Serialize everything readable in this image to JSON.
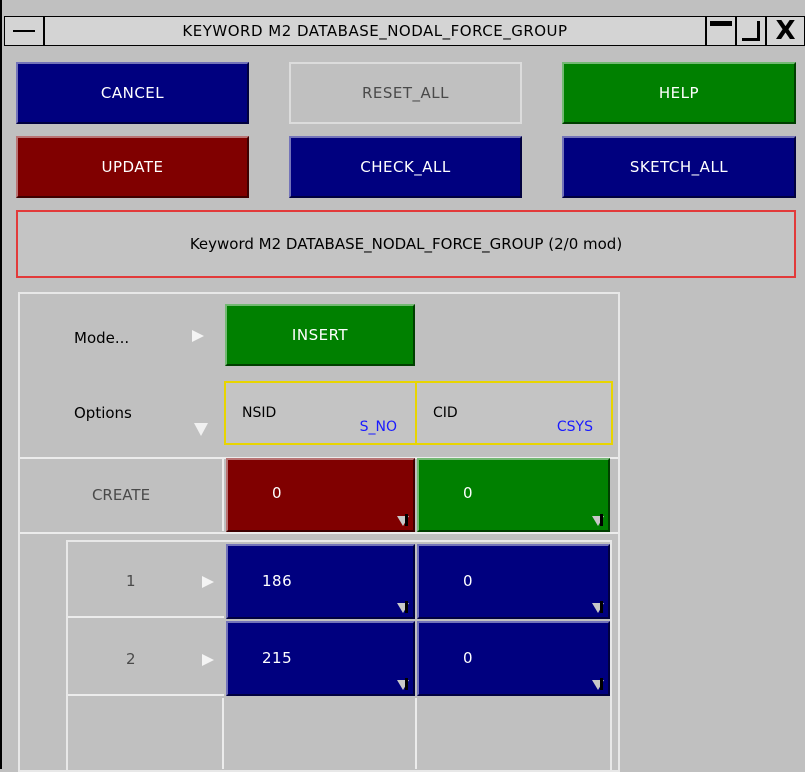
{
  "window": {
    "title": "KEYWORD M2 DATABASE_NODAL_FORCE_GROUP",
    "close_glyph": "X"
  },
  "toolbar": {
    "cancel": "CANCEL",
    "reset_all": "RESET_ALL",
    "help": "HELP",
    "update": "UPDATE",
    "check_all": "CHECK_ALL",
    "sketch_all": "SKETCH_ALL"
  },
  "status": "Keyword M2 DATABASE_NODAL_FORCE_GROUP (2/0 mod)",
  "mode": {
    "label": "Mode...",
    "value": "INSERT"
  },
  "options": {
    "label": "Options",
    "fields": [
      {
        "name": "NSID",
        "type": "S_NO"
      },
      {
        "name": "CID",
        "type": "CSYS"
      }
    ]
  },
  "create": {
    "label": "CREATE",
    "values": [
      "0",
      "0"
    ]
  },
  "rows": [
    {
      "index": "1",
      "nsid": "186",
      "cid": "0"
    },
    {
      "index": "2",
      "nsid": "215",
      "cid": "0"
    }
  ],
  "colors": {
    "navy": "#00007f",
    "maroon": "#800000",
    "green": "#008000",
    "status_border": "#e23a3a",
    "option_border": "#e8d500",
    "type_text": "#1a1aff"
  },
  "icons": [
    "window-menu-icon",
    "minimize-icon",
    "maximize-icon",
    "close-icon",
    "arrow-right-icon",
    "arrow-down-icon",
    "corner-popup-icon"
  ]
}
